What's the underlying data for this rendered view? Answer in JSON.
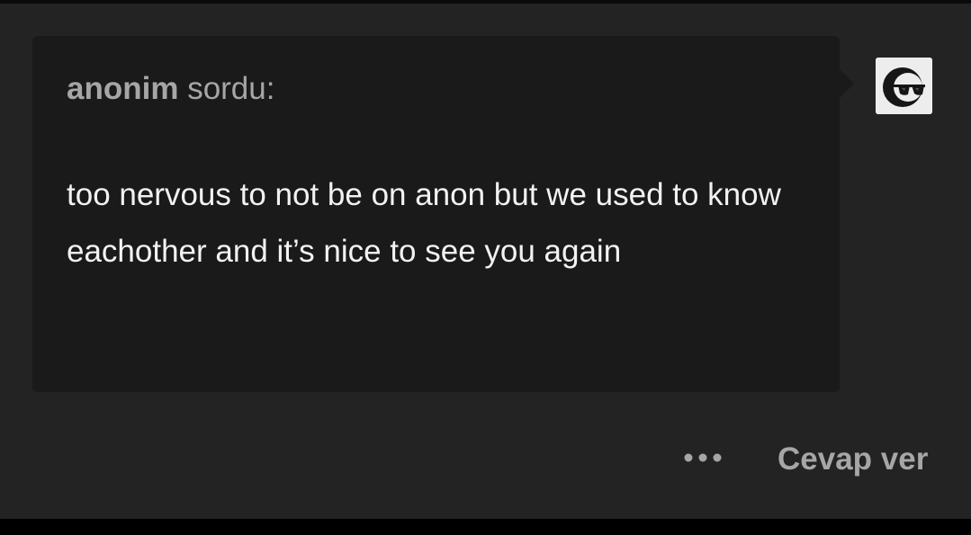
{
  "ask": {
    "asker_name": "anonim",
    "asker_verb": "sordu:",
    "question": "too nervous to not be on anon but we used to know eachother and it’s nice to see you again"
  },
  "avatar": {
    "icon": "anonymous-sunglasses-avatar"
  },
  "actions": {
    "more_icon": "more-dots-icon",
    "reply_label": "Cevap ver"
  },
  "colors": {
    "card_background": "#232323",
    "bubble_background": "#1a1a1a",
    "muted_text": "#a6a6a6",
    "body_text": "#f2f2f2"
  }
}
